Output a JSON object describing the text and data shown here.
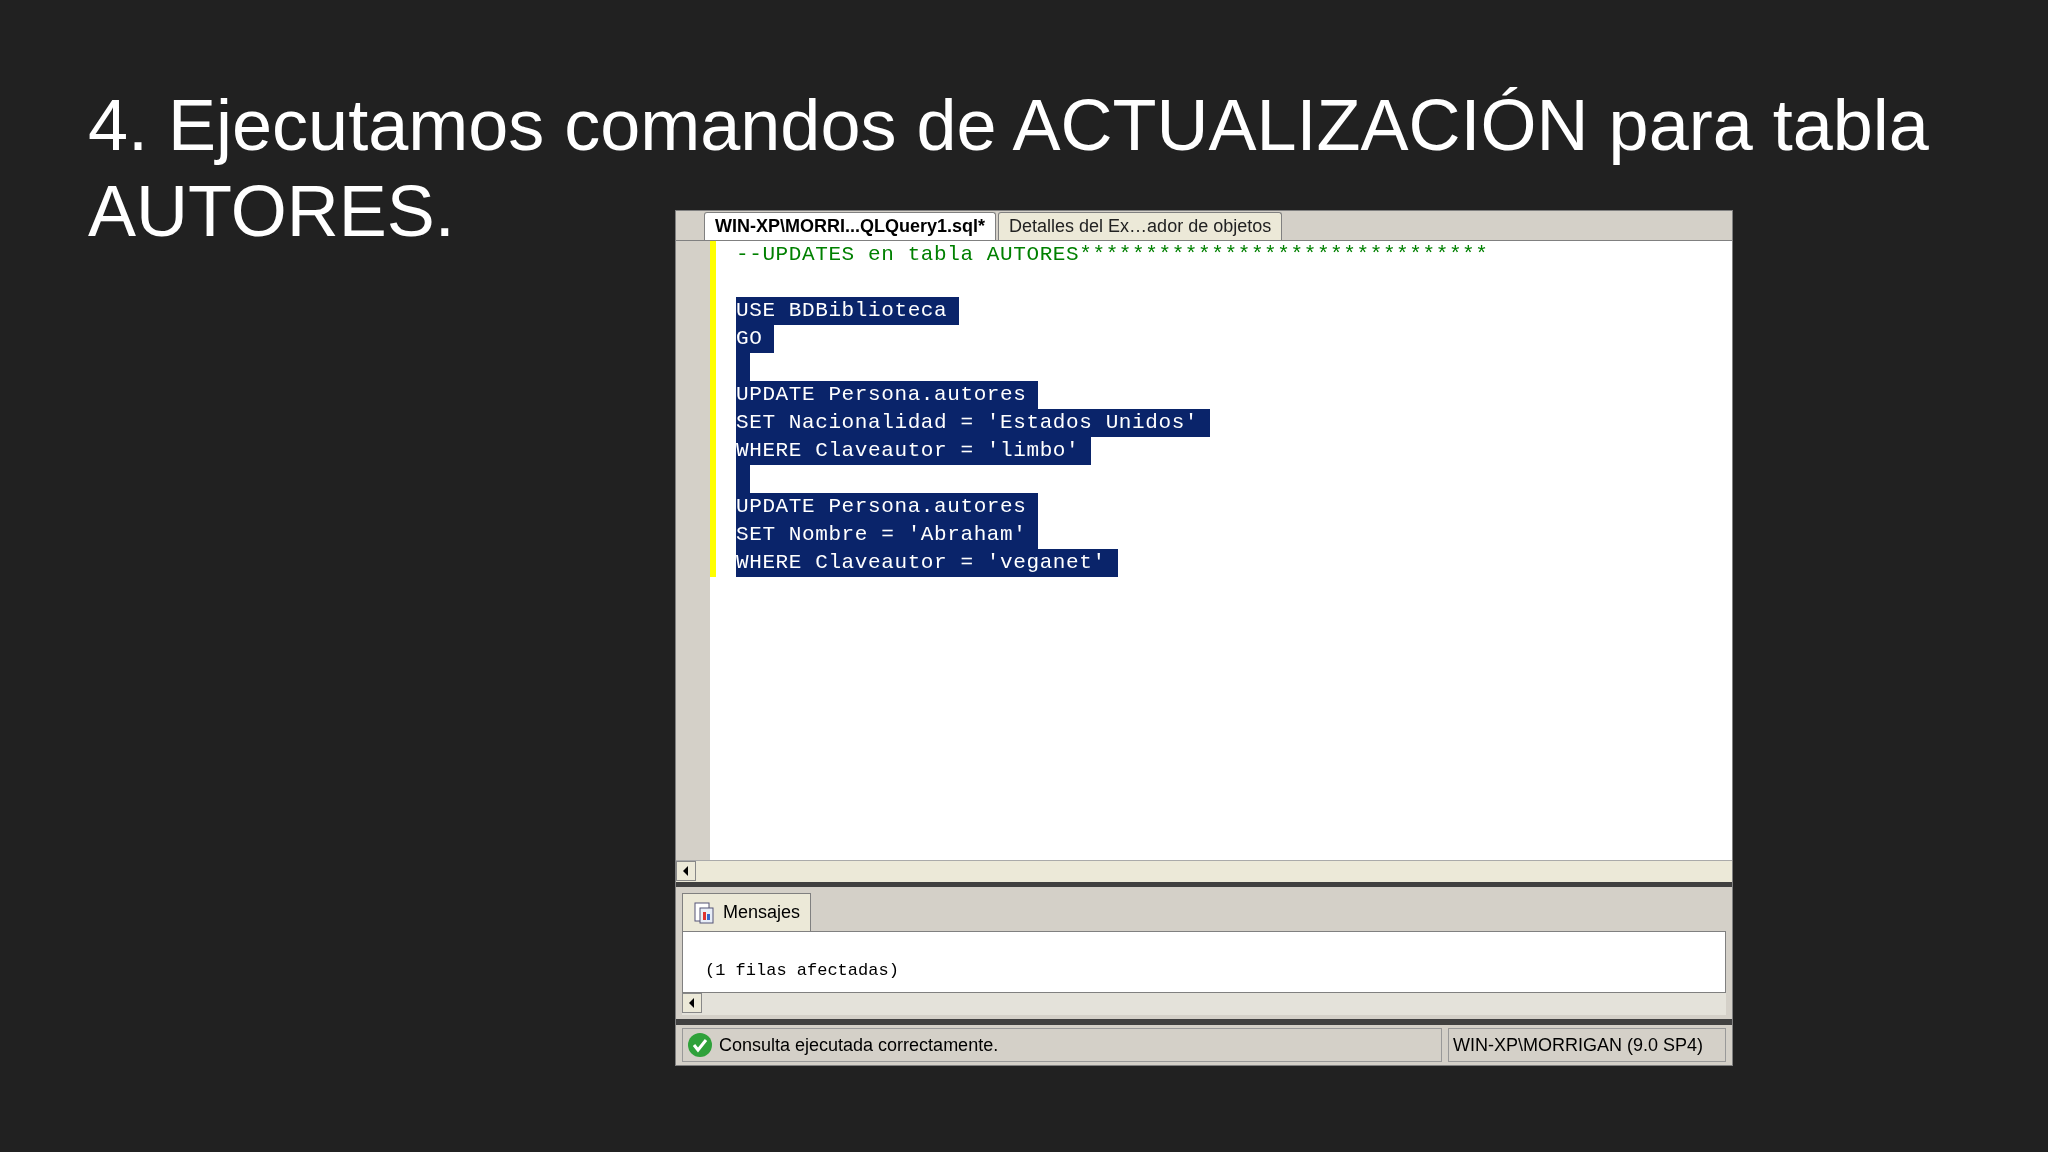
{
  "slide_title_lines": [
    "4. Ejecutamos comandos de ACTUALIZACIÓN para tabla",
    "AUTORES."
  ],
  "editor_tabs": [
    {
      "label": "WIN-XP\\MORRI...QLQuery1.sql*",
      "selected": true
    },
    {
      "label": "Detalles del Ex…ador de objetos",
      "selected": false
    }
  ],
  "code_lines": [
    {
      "kind": "comment",
      "text": "--UPDATES en tabla AUTORES*******************************",
      "selected": false
    },
    {
      "kind": "blank"
    },
    {
      "kind": "code",
      "text": "USE BDBiblioteca",
      "selected": true
    },
    {
      "kind": "code",
      "text": "GO",
      "selected": true
    },
    {
      "kind": "blank",
      "selected": true
    },
    {
      "kind": "code",
      "text": "UPDATE Persona.autores",
      "selected": true
    },
    {
      "kind": "code",
      "text": "SET Nacionalidad = 'Estados Unidos'",
      "selected": true
    },
    {
      "kind": "code",
      "text": "WHERE Claveautor = 'limbo'",
      "selected": true
    },
    {
      "kind": "blank",
      "selected": true
    },
    {
      "kind": "code",
      "text": "UPDATE Persona.autores",
      "selected": true
    },
    {
      "kind": "code",
      "text": "SET Nombre = 'Abraham'",
      "selected": true
    },
    {
      "kind": "code",
      "text": "WHERE Claveautor = 'veganet'",
      "selected": true
    }
  ],
  "results_tab": {
    "label": "Mensajes",
    "selected": true
  },
  "messages": [
    "(1 filas afectadas)"
  ],
  "status_bar": {
    "message": "Consulta ejecutada correctamente.",
    "server": "WIN-XP\\MORRIGAN (9.0 SP4)"
  }
}
